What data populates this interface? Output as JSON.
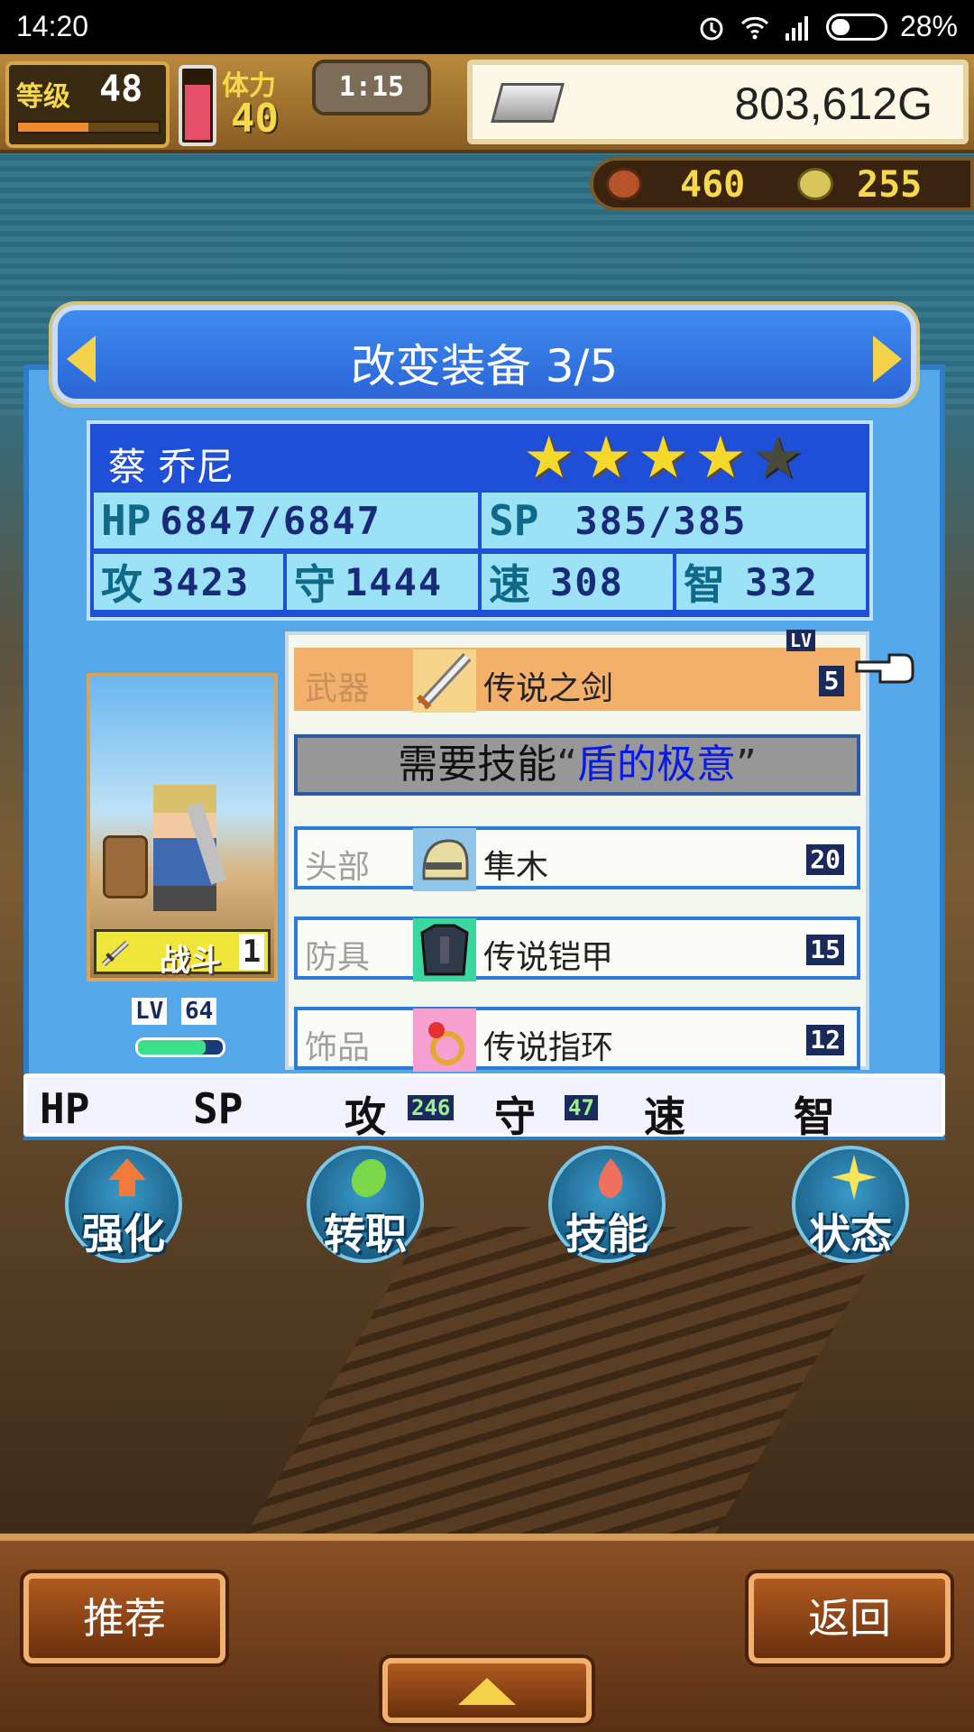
{
  "status_bar": {
    "time": "14:20",
    "battery": "28%"
  },
  "hud": {
    "level_label": "等级",
    "level": "48",
    "stamina_label": "体力",
    "stamina": "40",
    "timer": "1:15",
    "gold": "803,612G",
    "meat": "460",
    "medals": "255"
  },
  "panel": {
    "title": "改变装备 3/5",
    "character": {
      "name": "蔡 乔尼",
      "stars_filled": 4,
      "stars_total": 5,
      "hp_label": "HP",
      "hp": "6847/6847",
      "sp_label": "SP",
      "sp": "385/385",
      "atk_label": "攻",
      "atk": "3423",
      "def_label": "守",
      "def": "1444",
      "spd_label": "速",
      "spd": "308",
      "int_label": "智",
      "int": "332",
      "job": "战斗",
      "job_level": "1",
      "level_tag": "LV",
      "level": "64"
    },
    "equipment": {
      "lv_badge": "LV",
      "weapon": {
        "label": "武器",
        "name": "传说之剑",
        "lv": "5"
      },
      "requirement": {
        "prefix": "需要技能",
        "open_quote": "“",
        "skill": "盾的极意",
        "close_quote": "”"
      },
      "head": {
        "label": "头部",
        "name": "隼木",
        "lv": "20"
      },
      "armor": {
        "label": "防具",
        "name": "传说铠甲",
        "lv": "15"
      },
      "accessory": {
        "label": "饰品",
        "name": "传说指环",
        "lv": "12"
      }
    },
    "summary": {
      "hp": "HP",
      "sp": "SP",
      "atk": "攻",
      "atk_delta": "246",
      "def": "守",
      "def_delta": "47",
      "spd": "速",
      "int": "智"
    }
  },
  "actions": {
    "upgrade": "强化",
    "job_change": "转职",
    "skills": "技能",
    "status": "状态"
  },
  "bottom": {
    "recommend": "推荐",
    "back": "返回"
  }
}
